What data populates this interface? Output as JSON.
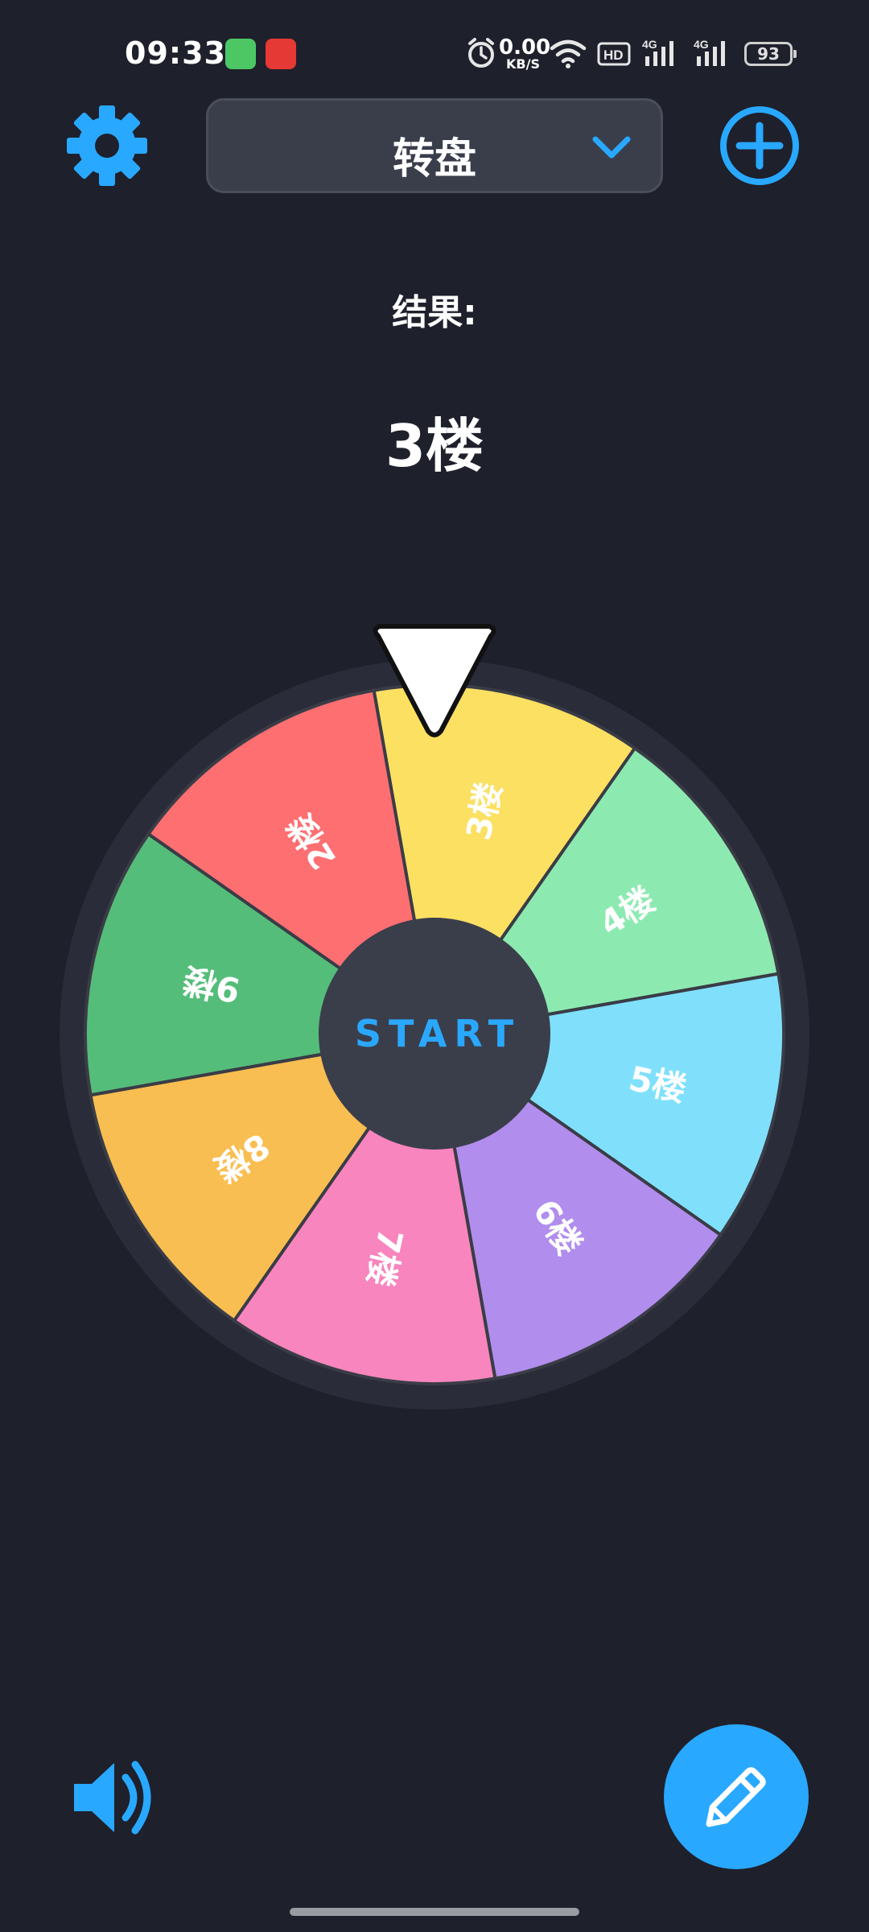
{
  "status_bar": {
    "time": "09:33",
    "net_speed_value": "0.00",
    "net_speed_unit": "KB/S",
    "battery": "93",
    "icons": [
      "messages-app-icon",
      "red-app-icon",
      "alarm-icon",
      "wifi-icon",
      "hd-icon",
      "signal-4g-icon",
      "signal-4g-icon"
    ]
  },
  "toolbar": {
    "settings_icon": "gear-icon",
    "title": "转盘",
    "dropdown_icon": "chevron-down-icon",
    "add_icon": "plus-circle-icon"
  },
  "result": {
    "label": "结果:",
    "value": "3楼"
  },
  "wheel": {
    "start_label": "START",
    "pointer_icon": "triangle-pointer-icon",
    "segments": [
      {
        "label": "3楼",
        "color": "#fbe062"
      },
      {
        "label": "4楼",
        "color": "#8ceab1"
      },
      {
        "label": "5楼",
        "color": "#80e0fc"
      },
      {
        "label": "6楼",
        "color": "#b18ded"
      },
      {
        "label": "7楼",
        "color": "#f885be"
      },
      {
        "label": "8楼",
        "color": "#f9be51"
      },
      {
        "label": "9楼",
        "color": "#55bd7a"
      },
      {
        "label": "2楼",
        "color": "#fd6f71"
      }
    ]
  },
  "bottom": {
    "sound_icon": "speaker-icon",
    "edit_icon": "pencil-icon"
  },
  "colors": {
    "background": "#1e202c",
    "accent": "#29a8ff",
    "panel": "#3a3e4b",
    "wheel_rim": "#2a2c39"
  }
}
